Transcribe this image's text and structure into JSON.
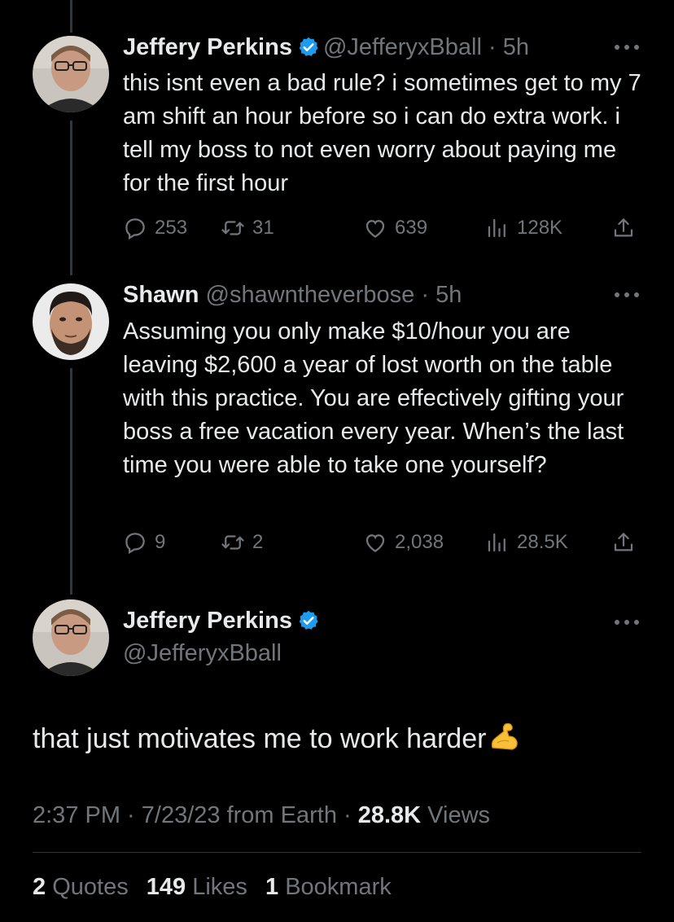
{
  "tweets": [
    {
      "name": "Jeffery Perkins",
      "handle": "@JefferyxBball",
      "time": "5h",
      "text": "this isnt even a bad rule? i sometimes get to my 7 am shift an hour before so i can do extra work. i tell my boss to not even worry about paying me for the first hour",
      "replies": "253",
      "retweets": "31",
      "likes": "639",
      "views": "128K"
    },
    {
      "name": "Shawn",
      "handle": "@shawntheverbose",
      "time": "5h",
      "text": "Assuming you only make $10/hour you are leaving $2,600 a year of lost worth on the table with this practice. You are effectively gifting your boss a free vacation every year. When’s the last time you were able to take one yourself?",
      "replies": "9",
      "retweets": "2",
      "likes": "2,038",
      "views": "28.5K"
    }
  ],
  "main_tweet": {
    "name": "Jeffery Perkins",
    "handle": "@JefferyxBball",
    "text": "that just motivates me to work harder",
    "emoji": "flexed-biceps",
    "timestamp": "2:37 PM · 7/23/23 from Earth · ",
    "views_count": "28.8K",
    "views_label": " Views",
    "quotes_count": "2",
    "quotes_label": "Quotes",
    "likes_count": "149",
    "likes_label": "Likes",
    "bookmarks_count": "1",
    "bookmarks_label": "Bookmark"
  },
  "colors": {
    "background": "#000000",
    "text": "#e7e9ea",
    "muted": "#71767b",
    "verified": "#1d9bf0"
  },
  "icons": [
    "reply-icon",
    "retweet-icon",
    "like-icon",
    "views-icon",
    "share-icon",
    "more-icon",
    "verified-icon"
  ]
}
